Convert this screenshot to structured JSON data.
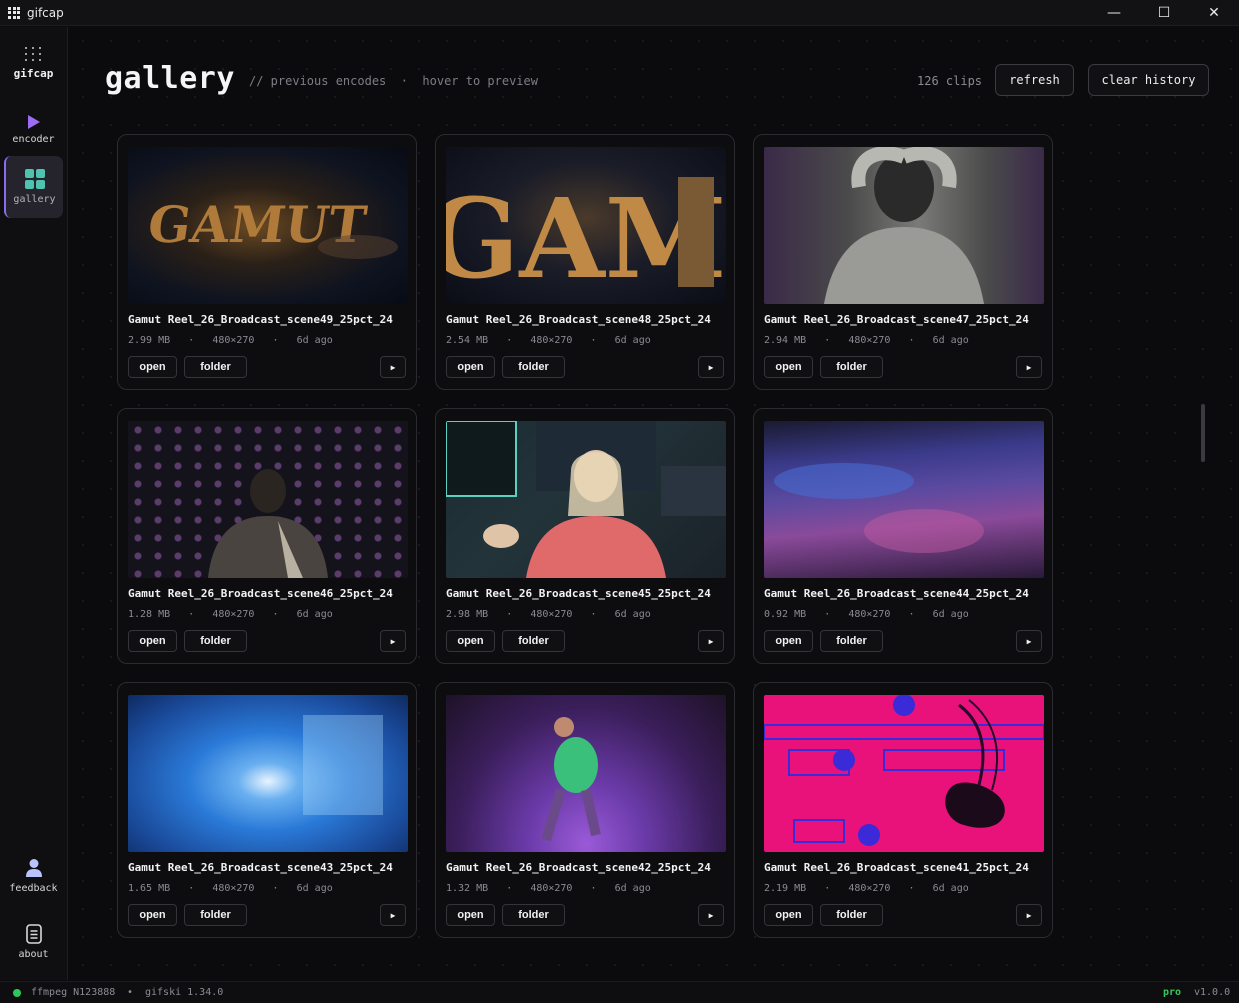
{
  "window": {
    "title": "gifcap",
    "controls": [
      "—",
      "☐",
      "✕"
    ]
  },
  "sidebar": {
    "brand": "gifcap",
    "items": [
      {
        "label": "encoder",
        "icon": "play-icon"
      },
      {
        "label": "gallery",
        "icon": "grid-icon",
        "active": true
      }
    ],
    "bottom": [
      {
        "label": "feedback",
        "icon": "user-icon"
      },
      {
        "label": "about",
        "icon": "document-icon"
      }
    ]
  },
  "header": {
    "title": "gallery",
    "subtitle": "// previous encodes  ·  hover to preview",
    "count": "126 clips",
    "refresh_label": "refresh",
    "clear_label": "clear history"
  },
  "card_buttons": {
    "open": "open",
    "folder": "folder"
  },
  "cards": [
    {
      "name": "Gamut Reel_26_Broadcast_scene49_25pct_24",
      "size": "2.99 MB",
      "dims": "480×270",
      "age": "6d ago"
    },
    {
      "name": "Gamut Reel_26_Broadcast_scene48_25pct_24",
      "size": "2.54 MB",
      "dims": "480×270",
      "age": "6d ago"
    },
    {
      "name": "Gamut Reel_26_Broadcast_scene47_25pct_24",
      "size": "2.94 MB",
      "dims": "480×270",
      "age": "6d ago"
    },
    {
      "name": "Gamut Reel_26_Broadcast_scene46_25pct_24",
      "size": "1.28 MB",
      "dims": "480×270",
      "age": "6d ago"
    },
    {
      "name": "Gamut Reel_26_Broadcast_scene45_25pct_24",
      "size": "2.98 MB",
      "dims": "480×270",
      "age": "6d ago"
    },
    {
      "name": "Gamut Reel_26_Broadcast_scene44_25pct_24",
      "size": "0.92 MB",
      "dims": "480×270",
      "age": "6d ago"
    },
    {
      "name": "Gamut Reel_26_Broadcast_scene43_25pct_24",
      "size": "1.65 MB",
      "dims": "480×270",
      "age": "6d ago"
    },
    {
      "name": "Gamut Reel_26_Broadcast_scene42_25pct_24",
      "size": "1.32 MB",
      "dims": "480×270",
      "age": "6d ago"
    },
    {
      "name": "Gamut Reel_26_Broadcast_scene41_25pct_24",
      "size": "2.19 MB",
      "dims": "480×270",
      "age": "6d ago"
    }
  ],
  "footer": {
    "ffmpeg": "ffmpeg N123888",
    "separator": "•",
    "gifski": "gifski 1.34.0",
    "tier": "pro",
    "version": "v1.0.0"
  },
  "colors": {
    "accent": "#8b6cf0",
    "gallery_icon": "#4ec4b0",
    "status_ok": "#2ec85a",
    "pro": "#35c95b"
  }
}
